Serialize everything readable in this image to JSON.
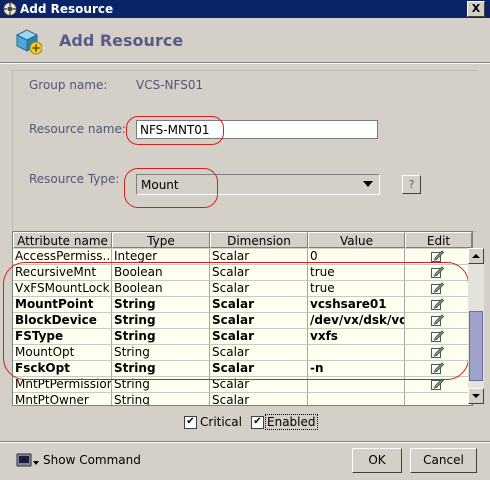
{
  "window": {
    "title": "Add Resource",
    "close_glyph": "X"
  },
  "banner": {
    "title": "Add Resource"
  },
  "form": {
    "group_label": "Group name:",
    "group_value": "VCS-NFS01",
    "resource_name_label": "Resource name:",
    "resource_name_value": "NFS-MNT01",
    "resource_type_label": "Resource Type:",
    "resource_type_value": "Mount",
    "help_glyph": "?"
  },
  "table": {
    "headers": [
      "Attribute name",
      "Type",
      "Dimension",
      "Value",
      "Edit"
    ],
    "rows": [
      {
        "name": "AccessPermiss...",
        "type": "Integer",
        "dimension": "Scalar",
        "value": "0"
      },
      {
        "name": "RecursiveMnt",
        "type": "Boolean",
        "dimension": "Scalar",
        "value": "true"
      },
      {
        "name": "VxFSMountLock",
        "type": "Boolean",
        "dimension": "Scalar",
        "value": "true"
      },
      {
        "name": "MountPoint",
        "type": "String",
        "dimension": "Scalar",
        "value": "vcshsare01"
      },
      {
        "name": "BlockDevice",
        "type": "String",
        "dimension": "Scalar",
        "value": "/dev/vx/dsk/vcs..."
      },
      {
        "name": "FSType",
        "type": "String",
        "dimension": "Scalar",
        "value": "vxfs"
      },
      {
        "name": "MountOpt",
        "type": "String",
        "dimension": "Scalar",
        "value": ""
      },
      {
        "name": "FsckOpt",
        "type": "String",
        "dimension": "Scalar",
        "value": "-n"
      },
      {
        "name": "MntPtPermission",
        "type": "String",
        "dimension": "Scalar",
        "value": ""
      },
      {
        "name": "MntPtOwner",
        "type": "String",
        "dimension": "Scalar",
        "value": ""
      }
    ]
  },
  "options": {
    "critical_label": "Critical",
    "critical_checked": true,
    "enabled_label": "Enabled",
    "enabled_checked": true,
    "check_glyph": "✔"
  },
  "footer": {
    "show_command_label": "Show Command",
    "ok_label": "OK",
    "cancel_label": "Cancel"
  },
  "colors": {
    "titlebar": "#0a246a",
    "dialog_bg": "#d4d0c8",
    "label_text": "#55547a",
    "cell_bg": "#fffff0",
    "annotation_red": "#d02020",
    "scroll_thumb": "#9fa3cc"
  }
}
